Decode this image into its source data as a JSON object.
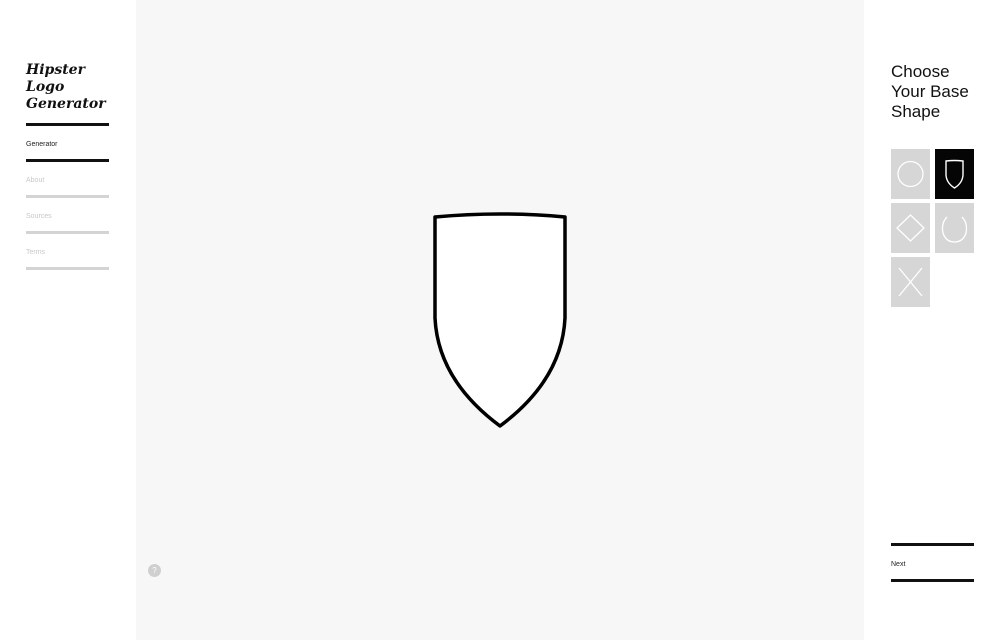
{
  "app": {
    "title": "Hipster Logo\nGenerator"
  },
  "nav": {
    "items": [
      {
        "label": "Generator",
        "active": true
      },
      {
        "label": "About",
        "active": false
      },
      {
        "label": "Sources",
        "active": false
      },
      {
        "label": "Terms",
        "active": false
      }
    ]
  },
  "canvas": {
    "background": "#f7f7f7",
    "shape": "shield",
    "stroke_color": "#000000",
    "info_icon": "info-icon",
    "info_label": "?"
  },
  "panel": {
    "heading": "Choose\nYour Base\nShape",
    "shapes": [
      {
        "name": "circle",
        "selected": false
      },
      {
        "name": "shield",
        "selected": true
      },
      {
        "name": "diamond",
        "selected": false
      },
      {
        "name": "horseshoe",
        "selected": false
      },
      {
        "name": "cross",
        "selected": false
      }
    ],
    "next_label": "Next"
  },
  "colors": {
    "accent": "#000000",
    "inactive": "#d6d6d6",
    "canvas": "#f7f7f7"
  }
}
